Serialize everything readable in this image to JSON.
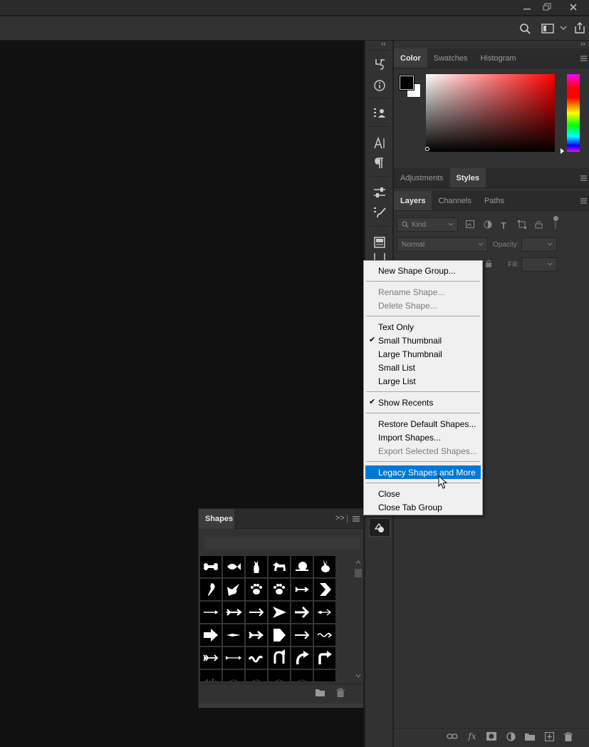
{
  "window": {
    "minimize_icon": "minimize-icon",
    "restore_icon": "restore-icon",
    "close_icon": "close-icon"
  },
  "options_bar": {
    "icons": [
      "search-icon",
      "workspace-icon",
      "chevron-down-icon",
      "share-icon"
    ]
  },
  "toolstrip": {
    "collapse_label": "‹‹",
    "icons": [
      "history-icon",
      "info-icon",
      "layer-comps-icon",
      "character-icon",
      "paragraph-icon",
      "adjustments-icon",
      "brush-settings-icon",
      "libraries-icon",
      "properties-icon",
      "shapes-icon"
    ]
  },
  "color_panel": {
    "tabs": [
      "Color",
      "Swatches",
      "Histogram"
    ],
    "active_tab": "Color",
    "foreground": "#000000",
    "background": "#ffffff",
    "collapse_label": "››"
  },
  "adjustments_panel": {
    "tabs": [
      "Adjustments",
      "Styles"
    ],
    "active_tab": "Styles"
  },
  "layers_panel": {
    "tabs": [
      "Layers",
      "Channels",
      "Paths"
    ],
    "active_tab": "Layers",
    "filter_placeholder": "Kind",
    "blend_mode": "Normal",
    "opacity_label": "Opacity:",
    "fill_label": "Fill:",
    "bottom_icons": [
      "link-icon",
      "fx-icon",
      "mask-icon",
      "adjustment-layer-icon",
      "group-folder-icon",
      "new-layer-icon",
      "trash-icon"
    ]
  },
  "context_menu": {
    "items": [
      {
        "label": "New Shape Group...",
        "enabled": true,
        "checked": false
      },
      {
        "label": "Rename Shape...",
        "enabled": false,
        "checked": false
      },
      {
        "label": "Delete Shape...",
        "enabled": false,
        "checked": false
      },
      {
        "label": "Text Only",
        "enabled": true,
        "checked": false
      },
      {
        "label": "Small Thumbnail",
        "enabled": true,
        "checked": true
      },
      {
        "label": "Large Thumbnail",
        "enabled": true,
        "checked": false
      },
      {
        "label": "Small List",
        "enabled": true,
        "checked": false
      },
      {
        "label": "Large List",
        "enabled": true,
        "checked": false
      },
      {
        "label": "Show Recents",
        "enabled": true,
        "checked": true
      },
      {
        "label": "Restore Default Shapes...",
        "enabled": true,
        "checked": false
      },
      {
        "label": "Import Shapes...",
        "enabled": true,
        "checked": false
      },
      {
        "label": "Export Selected Shapes...",
        "enabled": false,
        "checked": false
      },
      {
        "label": "Legacy Shapes and More",
        "enabled": true,
        "checked": false,
        "highlighted": true
      },
      {
        "label": "Close",
        "enabled": true,
        "checked": false
      },
      {
        "label": "Close Tab Group",
        "enabled": true,
        "checked": false
      }
    ],
    "check_glyph": "✔"
  },
  "shapes_panel": {
    "title": "Shapes",
    "expand_label": ">>",
    "shape_icons": [
      "bone-icon",
      "fish-icon",
      "cat-icon",
      "dog-icon",
      "snail-icon",
      "rabbit-icon",
      "parrot-icon",
      "dove-icon",
      "paw-print-icon",
      "paw-print-icon",
      "arrow-feather-icon",
      "chevron-right-icon",
      "arrow-thin-icon",
      "arrow-feathered-icon",
      "arrow-right-icon",
      "arrow-triangle-icon",
      "arrow-bold-icon",
      "arrow-decorative-icon",
      "arrow-block-icon",
      "arrow-dart-icon",
      "arrow-tail-icon",
      "arrow-pentagon-icon",
      "arrow-right-icon",
      "arrow-wave-icon",
      "arrow-fletched-icon",
      "arrow-long-icon",
      "arrow-squiggle-icon",
      "arrow-u-turn-icon",
      "arrow-curve-icon",
      "arrow-corner-icon",
      "grass-icon",
      "ornament-icon",
      "ornament-icon",
      "ornament-icon",
      "ornament-icon",
      "dots-icon"
    ],
    "folder_icon": "folder-icon",
    "trash_icon": "trash-icon"
  }
}
